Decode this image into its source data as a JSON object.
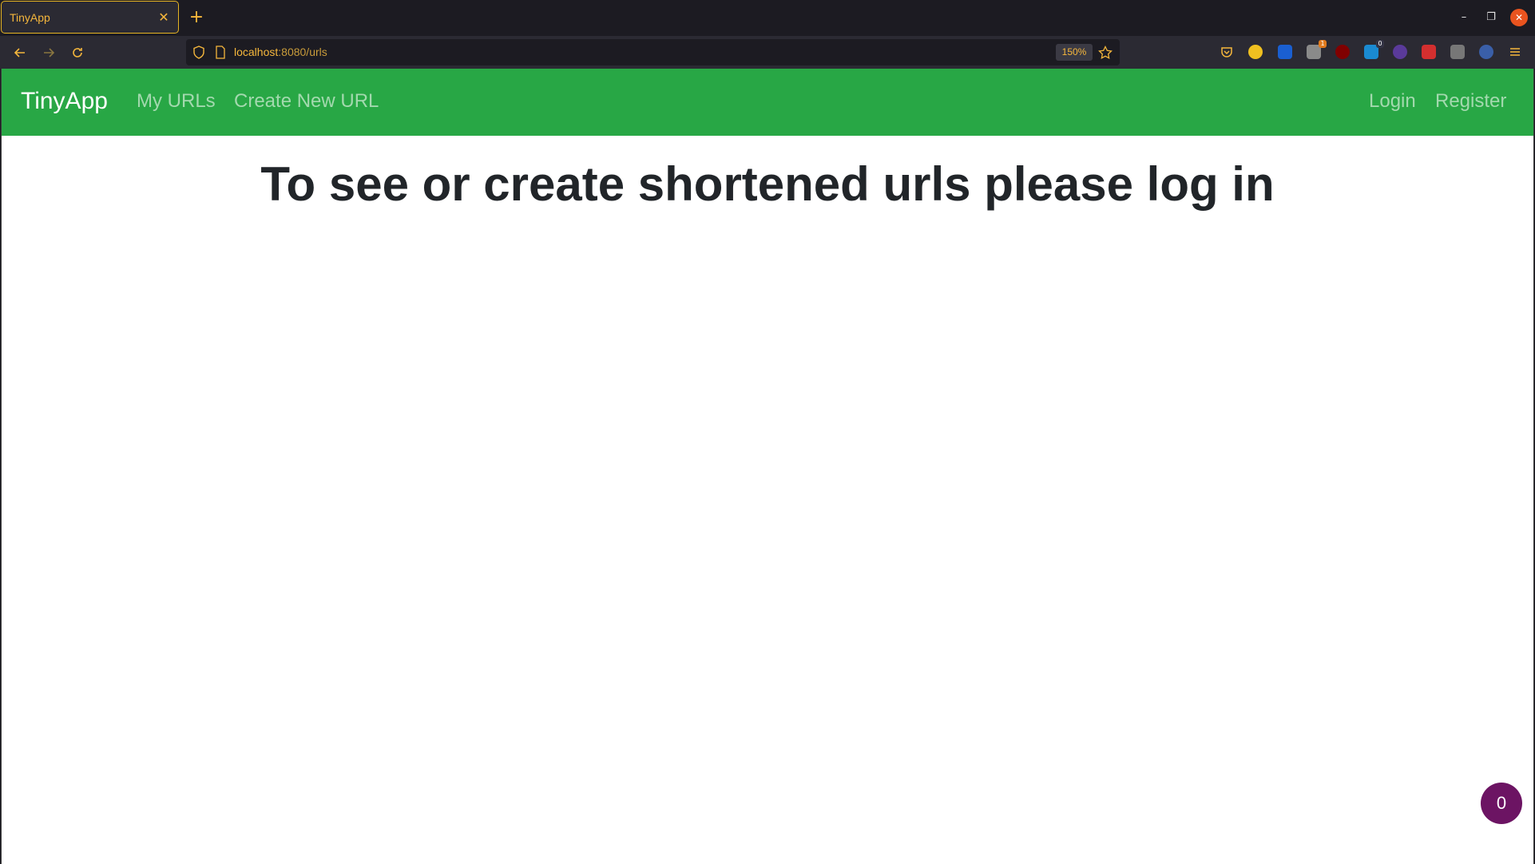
{
  "browser": {
    "tab_title": "TinyApp",
    "tab_close": "✕",
    "new_tab": "+",
    "url_host": "localhost",
    "url_rest": ":8080/urls",
    "zoom": "150%",
    "window_min": "–",
    "window_max": "❐",
    "window_close": "✕",
    "extension_badges": {
      "ext3": "1",
      "ext5": "0"
    }
  },
  "app": {
    "brand": "TinyApp",
    "nav_left": [
      "My URLs",
      "Create New URL"
    ],
    "nav_right": [
      "Login",
      "Register"
    ],
    "headline": "To see or create shortened urls please log in",
    "float_button": "0",
    "colors": {
      "navbar": "#28a745",
      "link": "#a3d9ae",
      "float_button": "#6c1463"
    }
  }
}
